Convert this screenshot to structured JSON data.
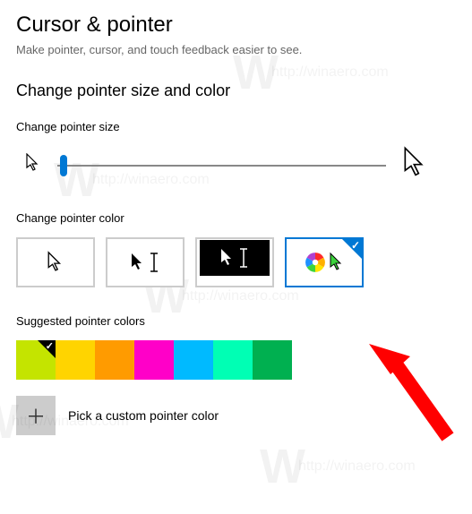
{
  "header": {
    "title": "Cursor & pointer",
    "subtitle": "Make pointer, cursor, and touch feedback easier to see."
  },
  "section": {
    "heading": "Change pointer size and color",
    "size_label": "Change pointer size",
    "color_label": "Change pointer color",
    "suggested_label": "Suggested pointer colors",
    "custom_label": "Pick a custom pointer color"
  },
  "slider": {
    "value_percent": 2
  },
  "color_options": {
    "selected_index": 3,
    "items": [
      {
        "name": "white-cursor"
      },
      {
        "name": "black-cursor"
      },
      {
        "name": "inverted-cursor"
      },
      {
        "name": "custom-color-cursor"
      }
    ]
  },
  "suggested_colors": {
    "selected_index": 0,
    "items": [
      {
        "hex": "#c4e400"
      },
      {
        "hex": "#ffd400"
      },
      {
        "hex": "#ff9b00"
      },
      {
        "hex": "#ff00c8"
      },
      {
        "hex": "#00baff"
      },
      {
        "hex": "#00ffb4"
      },
      {
        "hex": "#00b050"
      }
    ]
  },
  "watermark": {
    "text": "http://winaero.com"
  }
}
